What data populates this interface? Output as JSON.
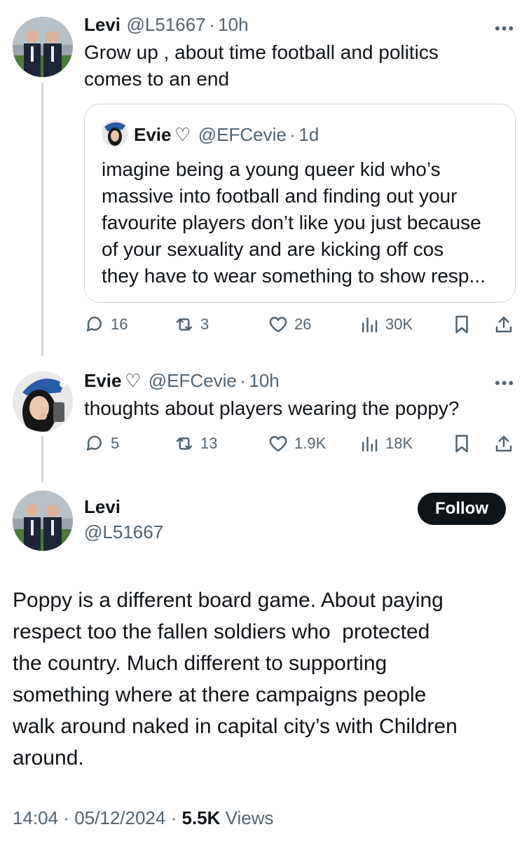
{
  "reply1": {
    "name": "Levi",
    "handle": "@L51667",
    "dot": "·",
    "time": "10h",
    "text_line1": "Grow up , about time football and politics",
    "text_line2": "comes to an end",
    "more_icon": "•••",
    "quote": {
      "name": "Evie",
      "heart": "♡",
      "handle": "@EFCevie",
      "dot": "·",
      "time": "1d",
      "lines": [
        "imagine being a young queer kid who’s",
        "massive into football and finding out your",
        "favourite players don’t like you just because",
        "of your sexuality and are kicking off cos",
        "they have to wear something to show resp..."
      ]
    },
    "actions": {
      "replies": "16",
      "reposts": "3",
      "likes": "26",
      "views": "30K"
    }
  },
  "reply2": {
    "name": "Evie",
    "heart": "♡",
    "handle": "@EFCevie",
    "dot": "·",
    "time": "10h",
    "text": "thoughts about players wearing the poppy?",
    "more_icon": "•••",
    "actions": {
      "replies": "5",
      "reposts": "13",
      "likes": "1.9K",
      "views": "18K"
    }
  },
  "main": {
    "name": "Levi",
    "handle": "@L51667",
    "follow_label": "Follow",
    "lines": [
      "Poppy is a different board game. About paying",
      "respect too the fallen soldiers who  protected",
      "the country. Much different to supporting",
      "something where at there campaigns people",
      "walk around naked in capital city’s with Children",
      "around."
    ],
    "time": "14:04",
    "dot1": "·",
    "date": "05/12/2024",
    "dot2": "·",
    "views_count": "5.5K",
    "views_label": "Views"
  },
  "colors": {
    "text": "#0f1419",
    "muted": "#536471",
    "border": "#cfd9de",
    "follow_bg": "#0f1419"
  }
}
